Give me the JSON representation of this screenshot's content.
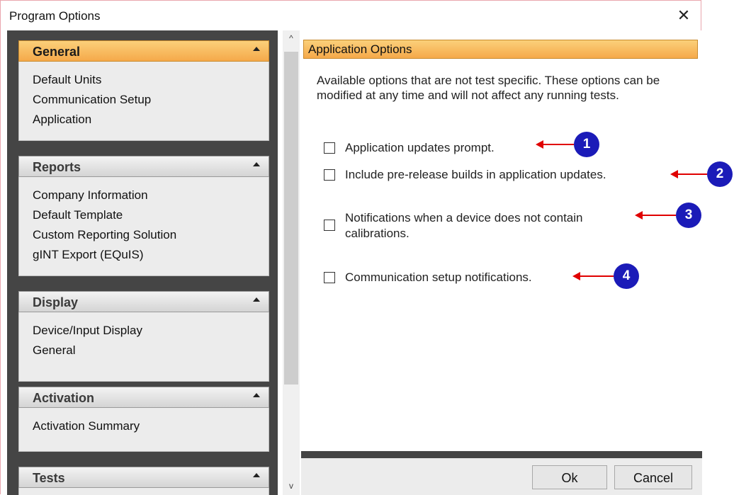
{
  "window": {
    "title": "Program Options",
    "close_glyph": "✕"
  },
  "sidebar": {
    "groups": [
      {
        "label": "General",
        "items": [
          "Default Units",
          "Communication Setup",
          "Application"
        ]
      },
      {
        "label": "Reports",
        "items": [
          "Company Information",
          "Default Template",
          "Custom Reporting Solution",
          "gINT Export (EQuIS)"
        ]
      },
      {
        "label": "Display",
        "items": [
          "Device/Input Display",
          "General"
        ]
      },
      {
        "label": "Activation",
        "items": [
          "Activation Summary"
        ]
      },
      {
        "label": "Tests",
        "items": []
      }
    ]
  },
  "scrollbar": {
    "up_glyph": "^",
    "down_glyph": "v"
  },
  "main": {
    "header": "Application Options",
    "description": "Available options that are not test specific.  These options can be modified at any time and will not affect any running tests.",
    "options": [
      {
        "label": "Application updates prompt.",
        "checked": false,
        "callout": "1"
      },
      {
        "label": "Include pre-release builds in application updates.",
        "checked": false,
        "callout": "2"
      },
      {
        "label": "Notifications when a device does not contain",
        "label_line2": "calibrations.",
        "checked": false,
        "callout": "3"
      },
      {
        "label": "Communication setup notifications.",
        "checked": false,
        "callout": "4"
      }
    ]
  },
  "buttons": {
    "ok": "Ok",
    "cancel": "Cancel"
  },
  "colors": {
    "accent_orange": "#f5a94a",
    "callout_blue": "#1b1bb8",
    "arrow_red": "#e00000",
    "panel_dark": "#454545"
  }
}
